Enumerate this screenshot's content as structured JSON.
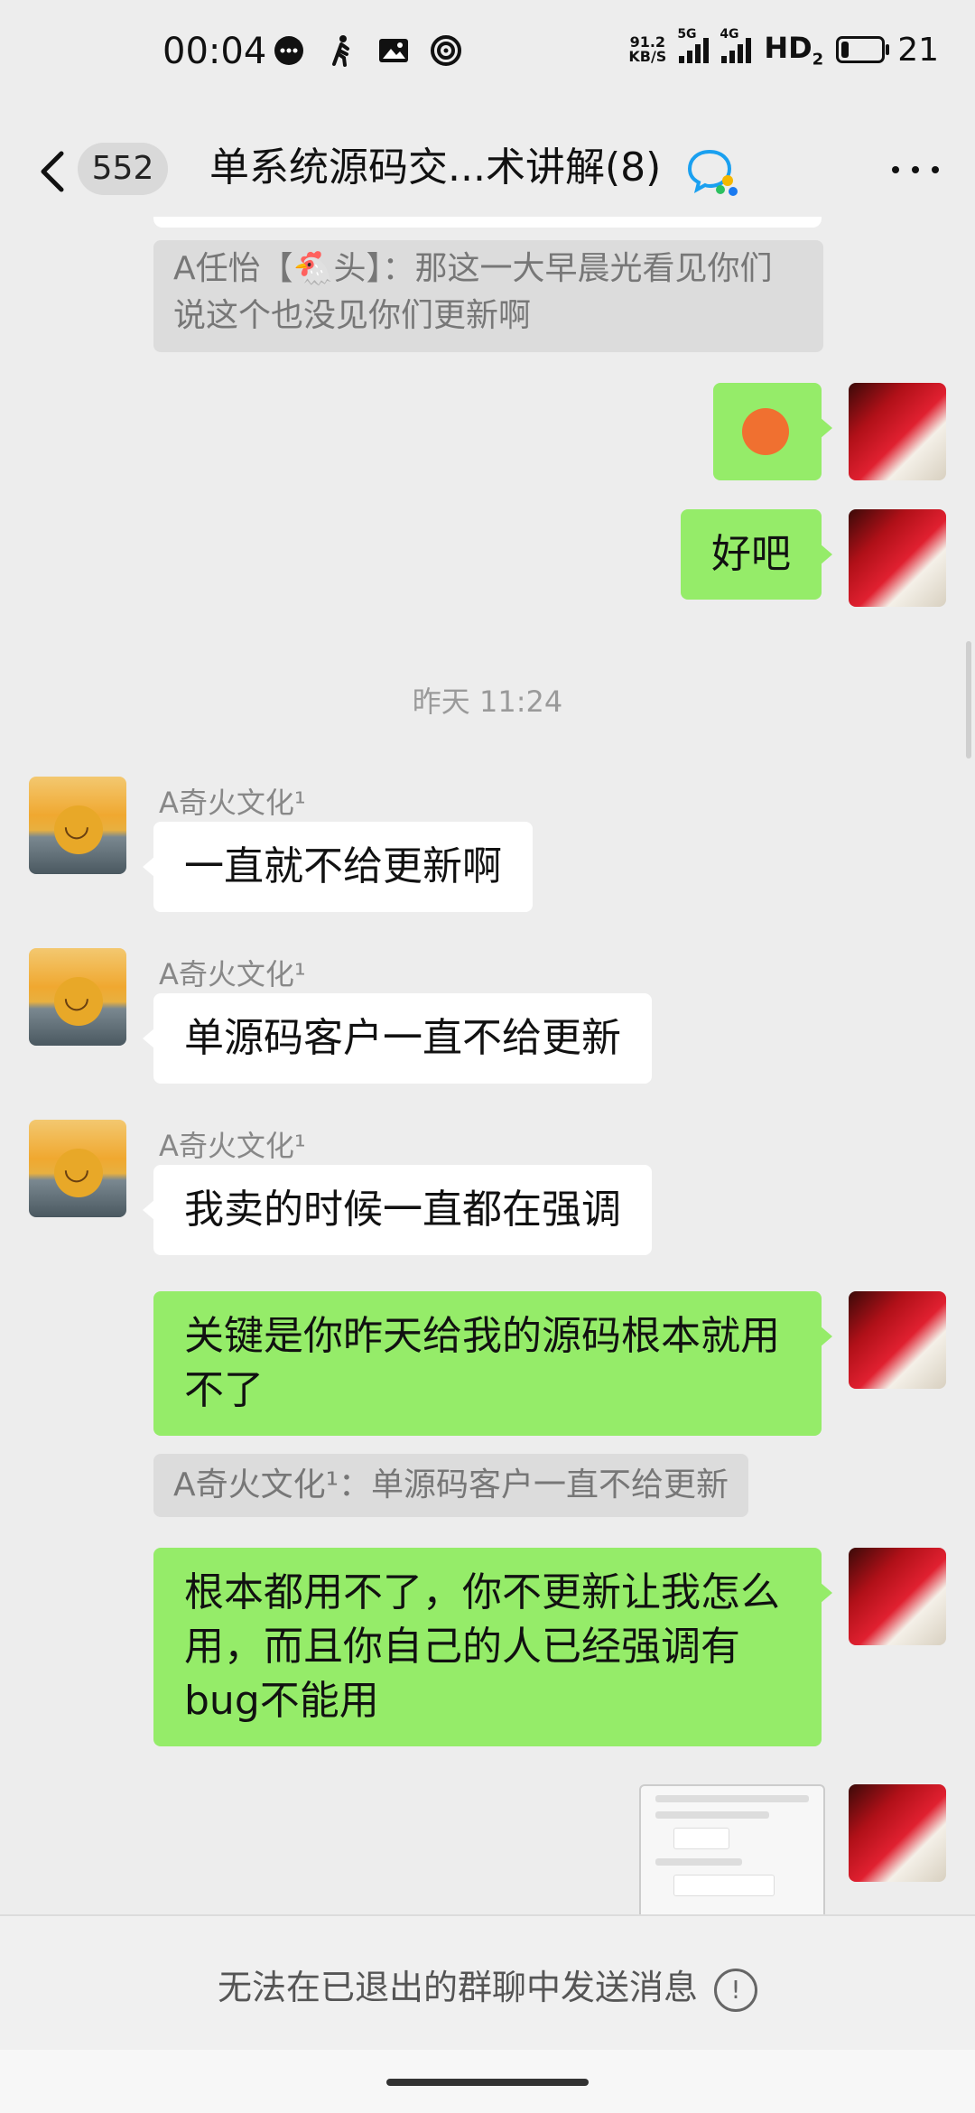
{
  "status_bar": {
    "time": "00:04",
    "net_speed_value": "91.2",
    "net_speed_unit": "KB/S",
    "sig1_tag": "5G",
    "sig2_tag": "4G",
    "hd": "HD",
    "hd_sub": "2",
    "battery": "21"
  },
  "header": {
    "unread_count": "552",
    "title": "单系统源码交...术讲解(8)"
  },
  "messages": {
    "quote1": "A任怡【🐔头】：那这一大早晨光看见你们说这个也没见你们更新啊",
    "self_emoji": "😥",
    "self_msg1": "好吧",
    "timestamp": "昨天 11:24",
    "sender": "A奇火文化¹",
    "other_msg1": "一直就不给更新啊",
    "other_msg2": "单源码客户一直不给更新",
    "other_msg3": "我卖的时候一直都在强调",
    "self_msg2": "关键是你昨天给我的源码根本就用不了",
    "quote2": "A奇火文化¹：单源码客户一直不给更新",
    "self_msg3": "根本都用不了，你不更新让我怎么用，而且你自己的人已经强调有bug不能用"
  },
  "footer": {
    "notice": "无法在已退出的群聊中发送消息",
    "info": "!"
  },
  "colors": {
    "background": "#ededed",
    "self_bubble": "#95ec69",
    "other_bubble": "#ffffff",
    "quote_bg": "#dcdcdc"
  }
}
